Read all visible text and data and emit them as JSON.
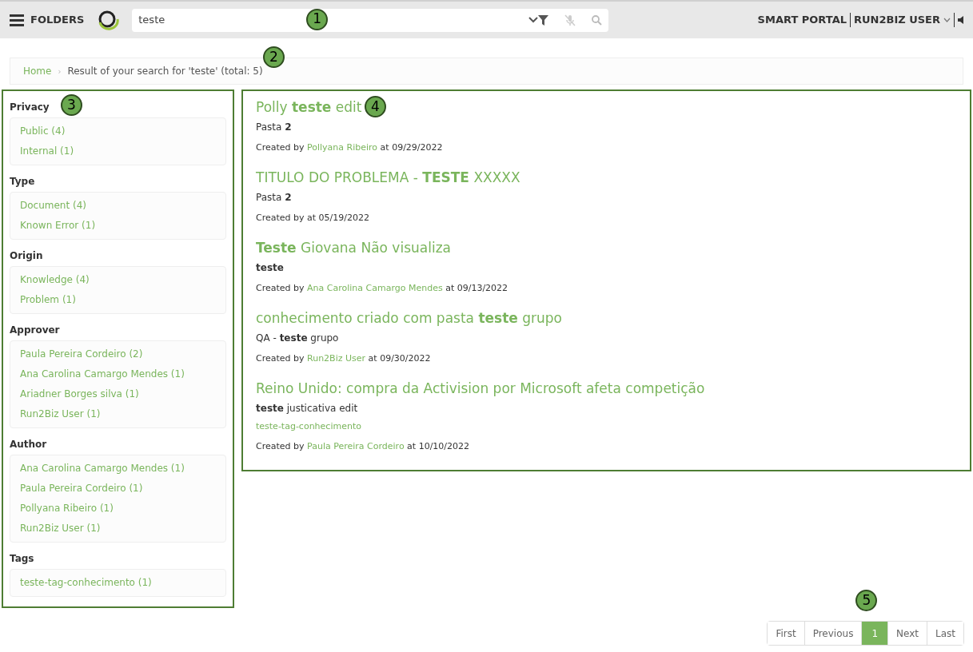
{
  "header": {
    "menu_label": "FOLDERS",
    "search": {
      "value": "teste",
      "callout": "1"
    },
    "portal": "SMART PORTAL",
    "user": "RUN2BIZ USER"
  },
  "breadcrumb": {
    "separator": "›",
    "items": [
      "Home",
      "Result of your search for 'teste' (total: 5)"
    ],
    "callout": "2"
  },
  "filters": {
    "callout": "3",
    "groups": [
      {
        "title": "Privacy",
        "items": [
          "Public (4)",
          "Internal (1)"
        ]
      },
      {
        "title": "Type",
        "items": [
          "Document (4)",
          "Known Error (1)"
        ]
      },
      {
        "title": "Origin",
        "items": [
          "Knowledge (4)",
          "Problem (1)"
        ]
      },
      {
        "title": "Approver",
        "items": [
          "Paula Pereira Cordeiro (2)",
          "Ana Carolina Camargo Mendes (1)",
          "Ariadner Borges silva (1)",
          "Run2Biz User (1)"
        ]
      },
      {
        "title": "Author",
        "items": [
          "Ana Carolina Camargo Mendes (1)",
          "Paula Pereira Cordeiro (1)",
          "Pollyana Ribeiro (1)",
          "Run2Biz User (1)"
        ]
      },
      {
        "title": "Tags",
        "items": [
          "teste-tag-conhecimento (1)"
        ]
      }
    ]
  },
  "results": {
    "callout": "4",
    "items": [
      {
        "title": "Polly **teste** edit",
        "folder": "Pasta **2**",
        "created_by": "Created by",
        "author": "Pollyana Ribeiro",
        "at": "at 09/29/2022"
      },
      {
        "title": "TITULO DO PROBLEMA - **TESTE** XXXXX",
        "folder": "Pasta **2**",
        "created_by": "Created by",
        "at": "at 05/19/2022"
      },
      {
        "title": "**Teste** Giovana Não visualiza",
        "folder": "**teste**",
        "created_by": "Created by",
        "author": "Ana Carolina Camargo Mendes",
        "at": "at 09/13/2022"
      },
      {
        "title": "conhecimento criado com pasta **teste** grupo",
        "folder": "QA - **teste** grupo",
        "created_by": "Created by",
        "author": "Run2Biz User",
        "at": "at 09/30/2022"
      },
      {
        "title": "Reino Unido: compra da Activision por Microsoft afeta competição",
        "folder": "**teste** justicativa edit",
        "tag": "teste-tag-conhecimento",
        "created_by": "Created by",
        "author": "Paula Pereira Cordeiro",
        "at": "at 10/10/2022"
      }
    ]
  },
  "pagination": {
    "callout": "5",
    "pages": [
      {
        "label": "First",
        "selected": false
      },
      {
        "label": "Previous",
        "selected": false
      },
      {
        "label": "1",
        "selected": true
      },
      {
        "label": "Next",
        "selected": false
      },
      {
        "label": "Last",
        "selected": false
      }
    ]
  }
}
